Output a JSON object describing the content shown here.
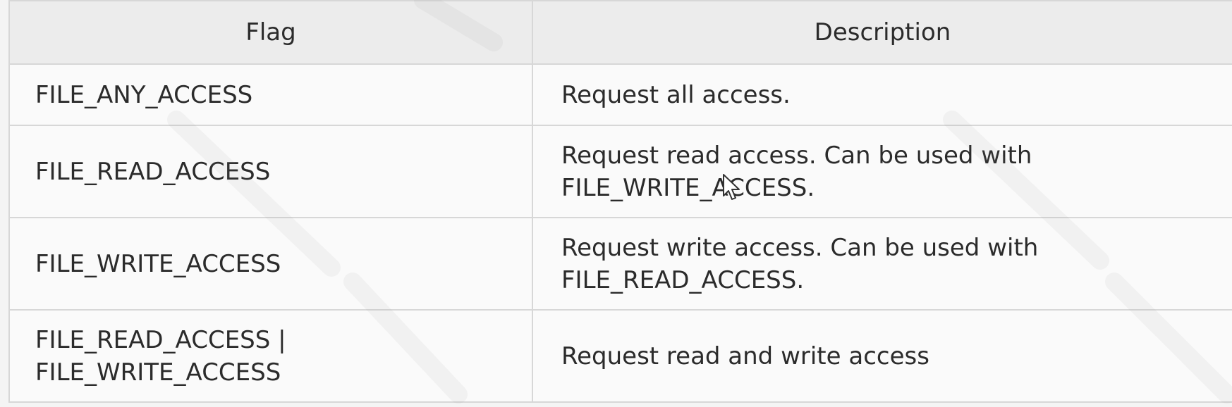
{
  "table": {
    "headers": {
      "flag": "Flag",
      "description": "Description"
    },
    "rows": [
      {
        "flag": "FILE_ANY_ACCESS",
        "description": "Request all access."
      },
      {
        "flag": "FILE_READ_ACCESS",
        "description": "Request read access. Can be used with\nFILE_WRITE_ACCESS."
      },
      {
        "flag": "FILE_WRITE_ACCESS",
        "description": "Request write access. Can be used with\nFILE_READ_ACCESS."
      },
      {
        "flag": "FILE_READ_ACCESS |\nFILE_WRITE_ACCESS",
        "description": "Request read and write access"
      }
    ]
  }
}
